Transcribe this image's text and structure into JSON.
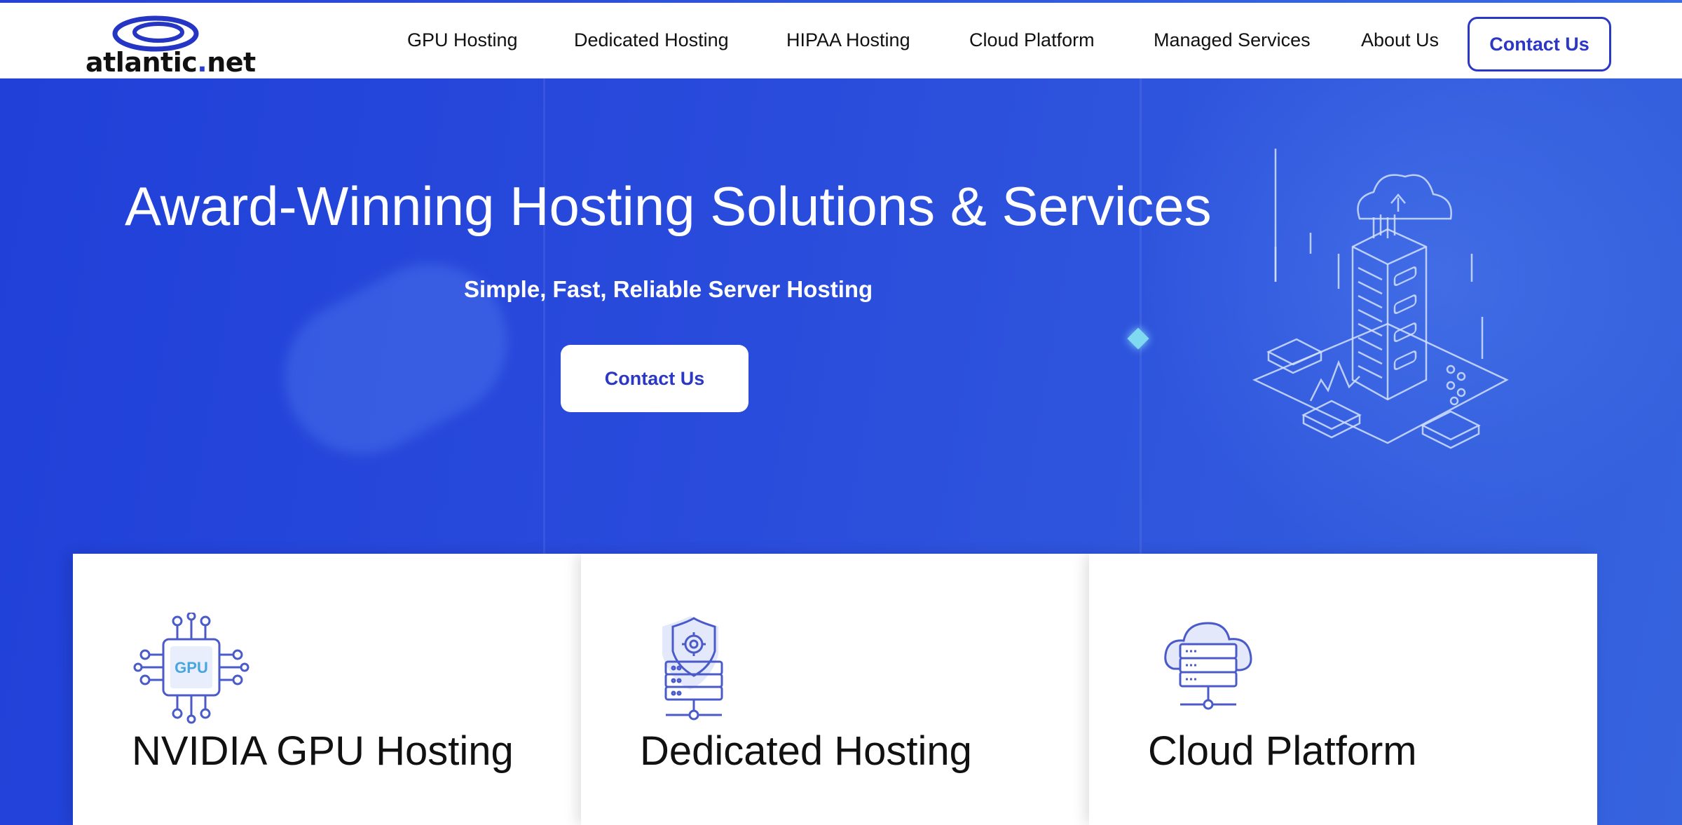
{
  "brand": {
    "name_prefix": "atlantic",
    "name_dot": ".",
    "name_suffix": "net"
  },
  "nav": {
    "items": [
      {
        "label": "GPU Hosting"
      },
      {
        "label": "Dedicated Hosting"
      },
      {
        "label": "HIPAA Hosting"
      },
      {
        "label": "Cloud Platform"
      },
      {
        "label": "Managed Services"
      },
      {
        "label": "About Us"
      }
    ],
    "contact_label": "Contact Us"
  },
  "hero": {
    "title": "Award-Winning Hosting Solutions & Services",
    "subtitle": "Simple, Fast, Reliable Server Hosting",
    "cta_label": "Contact Us"
  },
  "cards": [
    {
      "title": "NVIDIA GPU Hosting",
      "icon": "gpu-chip-icon",
      "icon_text": "GPU"
    },
    {
      "title": "Dedicated Hosting",
      "icon": "shield-server-icon"
    },
    {
      "title": "Cloud Platform",
      "icon": "cloud-server-icon"
    }
  ],
  "colors": {
    "accent": "#2b37c5",
    "hero_bg": "#2a4cdc",
    "icon_stroke": "#4a5bc9"
  }
}
